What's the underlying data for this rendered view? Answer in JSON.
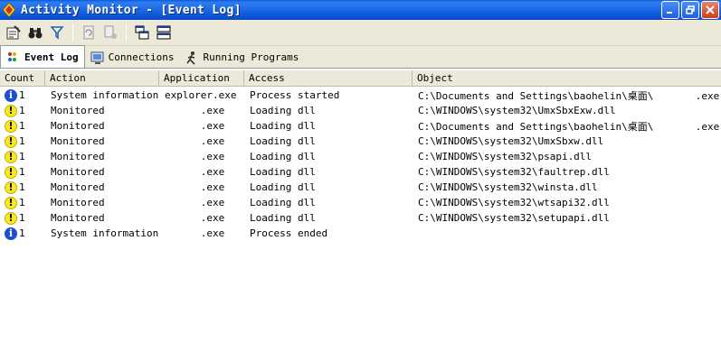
{
  "window": {
    "title": "Activity Monitor - [Event Log]"
  },
  "toolbar": {
    "buttons": [
      "properties-icon",
      "find-icon",
      "filter-icon",
      "refresh-icon",
      "clear-icon",
      "cascade-icon",
      "tile-icon"
    ]
  },
  "tabs": [
    {
      "label": "Event Log",
      "active": true
    },
    {
      "label": "Connections",
      "active": false
    },
    {
      "label": "Running Programs",
      "active": false
    }
  ],
  "columns": {
    "count": "Count",
    "action": "Action",
    "application": "Application",
    "access": "Access",
    "object": "Object"
  },
  "rows": [
    {
      "type": "info",
      "count": "1",
      "action": "System information",
      "application": "explorer.exe",
      "access": "Process started",
      "object": "C:\\Documents and Settings\\baohelin\\桌面\\       .exe"
    },
    {
      "type": "warning",
      "count": "1",
      "action": "Monitored",
      "application": "      .exe",
      "access": "Loading dll",
      "object": "C:\\WINDOWS\\system32\\UmxSbxExw.dll"
    },
    {
      "type": "warning",
      "count": "1",
      "action": "Monitored",
      "application": "      .exe",
      "access": "Loading dll",
      "object": "C:\\Documents and Settings\\baohelin\\桌面\\       .exe"
    },
    {
      "type": "warning",
      "count": "1",
      "action": "Monitored",
      "application": "      .exe",
      "access": "Loading dll",
      "object": "C:\\WINDOWS\\system32\\UmxSbxw.dll"
    },
    {
      "type": "warning",
      "count": "1",
      "action": "Monitored",
      "application": "      .exe",
      "access": "Loading dll",
      "object": "C:\\WINDOWS\\system32\\psapi.dll"
    },
    {
      "type": "warning",
      "count": "1",
      "action": "Monitored",
      "application": "      .exe",
      "access": "Loading dll",
      "object": "C:\\WINDOWS\\system32\\faultrep.dll"
    },
    {
      "type": "warning",
      "count": "1",
      "action": "Monitored",
      "application": "      .exe",
      "access": "Loading dll",
      "object": "C:\\WINDOWS\\system32\\winsta.dll"
    },
    {
      "type": "warning",
      "count": "1",
      "action": "Monitored",
      "application": "      .exe",
      "access": "Loading dll",
      "object": "C:\\WINDOWS\\system32\\wtsapi32.dll"
    },
    {
      "type": "warning",
      "count": "1",
      "action": "Monitored",
      "application": "      .exe",
      "access": "Loading dll",
      "object": "C:\\WINDOWS\\system32\\setupapi.dll"
    },
    {
      "type": "info",
      "count": "1",
      "action": "System information",
      "application": "      .exe",
      "access": "Process ended",
      "object": ""
    }
  ],
  "icons": {
    "info": "i",
    "warning": "!"
  },
  "colors": {
    "titlebar": "#0a5bdc",
    "info_icon": "#1b4fd1",
    "warning_icon": "#f8e81c"
  }
}
